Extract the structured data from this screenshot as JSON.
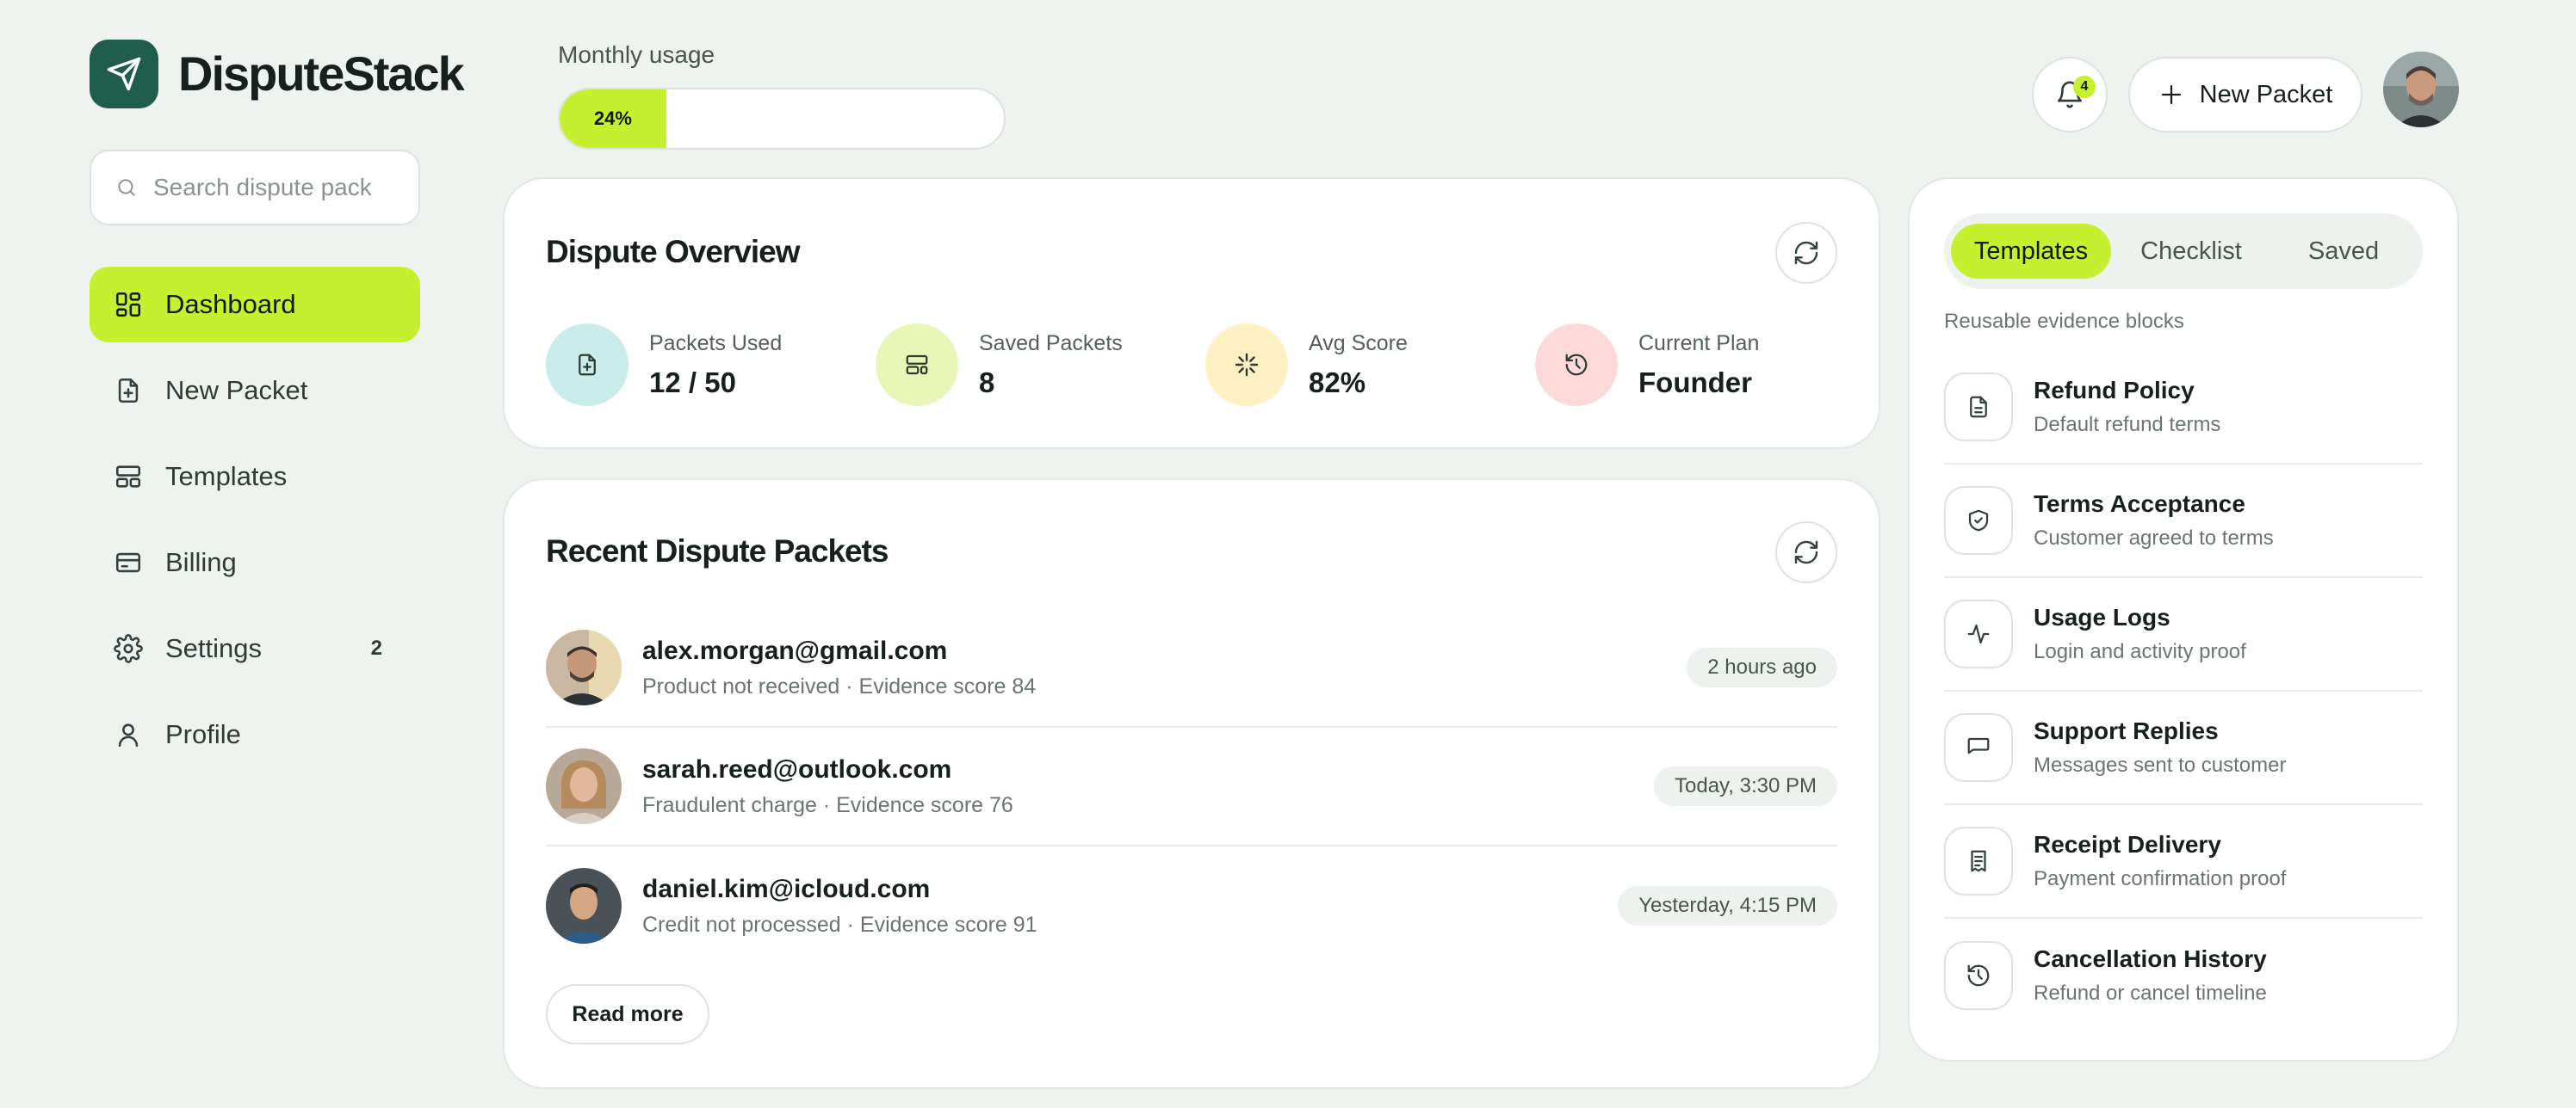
{
  "brand": {
    "name": "DisputeStack"
  },
  "search": {
    "placeholder": "Search dispute pack"
  },
  "sidebar": {
    "items": [
      {
        "label": "Dashboard",
        "icon": "dashboard-grid-icon",
        "active": true
      },
      {
        "label": "New Packet",
        "icon": "file-plus-icon"
      },
      {
        "label": "Templates",
        "icon": "templates-icon"
      },
      {
        "label": "Billing",
        "icon": "credit-card-icon"
      },
      {
        "label": "Settings",
        "icon": "gear-icon",
        "badge": "2"
      },
      {
        "label": "Profile",
        "icon": "user-icon"
      }
    ]
  },
  "usage": {
    "label": "Monthly usage",
    "percent_text": "24%",
    "percent": 24
  },
  "header": {
    "notification_count": "4",
    "new_packet_label": "New Packet"
  },
  "overview": {
    "title": "Dispute Overview",
    "stats": [
      {
        "label": "Packets Used",
        "value": "12 / 50",
        "icon": "file-plus-icon",
        "color": "#c9ecea"
      },
      {
        "label": "Saved Packets",
        "value": "8",
        "icon": "layout-icon",
        "color": "#e8f7b8"
      },
      {
        "label": "Avg Score",
        "value": "82%",
        "icon": "sparkle-icon",
        "color": "#fdf0c2"
      },
      {
        "label": "Current Plan",
        "value": "Founder",
        "icon": "history-icon",
        "color": "#fcdada"
      }
    ]
  },
  "recent": {
    "title": "Recent Dispute Packets",
    "items": [
      {
        "email": "alex.morgan@gmail.com",
        "reason": "Product not received",
        "score": "Evidence score 84",
        "time": "2 hours ago"
      },
      {
        "email": "sarah.reed@outlook.com",
        "reason": "Fraudulent charge",
        "score": "Evidence score 76",
        "time": "Today, 3:30 PM"
      },
      {
        "email": "daniel.kim@icloud.com",
        "reason": "Credit not processed",
        "score": "Evidence score 91",
        "time": "Yesterday, 4:15 PM"
      }
    ],
    "read_more": "Read more"
  },
  "templates_panel": {
    "tabs": [
      "Templates",
      "Checklist",
      "Saved"
    ],
    "active_tab": "Templates",
    "caption": "Reusable evidence blocks",
    "items": [
      {
        "title": "Refund Policy",
        "sub": "Default refund terms",
        "icon": "document-icon"
      },
      {
        "title": "Terms Acceptance",
        "sub": "Customer agreed to terms",
        "icon": "shield-check-icon"
      },
      {
        "title": "Usage Logs",
        "sub": "Login and activity proof",
        "icon": "activity-icon"
      },
      {
        "title": "Support Replies",
        "sub": "Messages sent to customer",
        "icon": "message-icon"
      },
      {
        "title": "Receipt Delivery",
        "sub": "Payment confirmation proof",
        "icon": "receipt-icon"
      },
      {
        "title": "Cancellation History",
        "sub": "Refund or cancel timeline",
        "icon": "history-icon"
      }
    ]
  },
  "colors": {
    "accent": "#c6f02f",
    "brand": "#1f5c4b",
    "background": "#eff3f0"
  }
}
